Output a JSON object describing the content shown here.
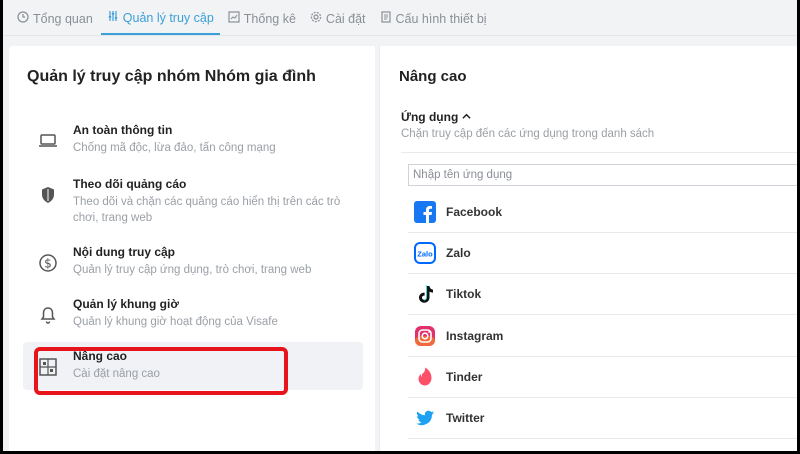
{
  "tabs": [
    {
      "label": "Tổng quan",
      "icon": "clock-icon"
    },
    {
      "label": "Quản lý truy cập",
      "icon": "sliders-icon"
    },
    {
      "label": "Thống kê",
      "icon": "chart-icon"
    },
    {
      "label": "Cài đặt",
      "icon": "gear-icon"
    },
    {
      "label": "Cấu hình thiết bị",
      "icon": "device-icon"
    }
  ],
  "left": {
    "title": "Quản lý truy cập nhóm Nhóm gia đình",
    "items": [
      {
        "title": "An toàn thông tin",
        "sub": "Chống mã độc, lừa đảo, tấn công mạng",
        "icon": "laptop-icon"
      },
      {
        "title": "Theo dõi quảng cáo",
        "sub": "Theo dõi và chặn các quảng cáo hiển thị trên các trò chơi, trang web",
        "icon": "shield-icon"
      },
      {
        "title": "Nội dung truy cập",
        "sub": "Quản lý truy cập ứng dụng, trò chơi, trang web",
        "icon": "dollar-icon"
      },
      {
        "title": "Quản lý khung giờ",
        "sub": "Quản lý khung giờ hoạt động của Visafe",
        "icon": "bell-icon"
      },
      {
        "title": "Nâng cao",
        "sub": "Cài đặt nâng cao",
        "icon": "grid-icon"
      }
    ]
  },
  "right": {
    "title": "Nâng cao",
    "section_title": "Ứng dụng",
    "section_sub": "Chặn truy cập đến các ứng dụng trong danh sách",
    "search_placeholder": "Nhập tên ứng dụng",
    "apps": [
      {
        "name": "Facebook",
        "icon": "facebook-icon"
      },
      {
        "name": "Zalo",
        "icon": "zalo-icon"
      },
      {
        "name": "Tiktok",
        "icon": "tiktok-icon"
      },
      {
        "name": "Instagram",
        "icon": "instagram-icon"
      },
      {
        "name": "Tinder",
        "icon": "tinder-icon"
      },
      {
        "name": "Twitter",
        "icon": "twitter-icon"
      }
    ]
  },
  "colors": {
    "accent": "#3b9fd8",
    "highlight": "#e8141c"
  }
}
